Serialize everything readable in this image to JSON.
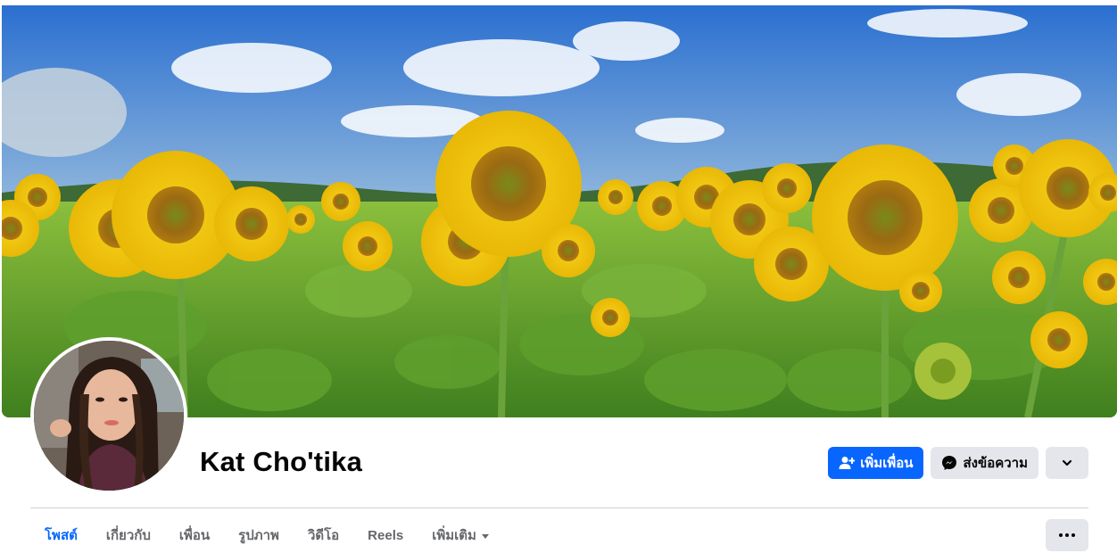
{
  "profile": {
    "name": "Kat Cho'tika"
  },
  "actions": {
    "add_friend_label": "เพิ่มเพื่อน",
    "message_label": "ส่งข้อความ"
  },
  "tabs": [
    {
      "label": "โพสต์",
      "active": true
    },
    {
      "label": "เกี่ยวกับ",
      "active": false
    },
    {
      "label": "เพื่อน",
      "active": false
    },
    {
      "label": "รูปภาพ",
      "active": false
    },
    {
      "label": "วิดีโอ",
      "active": false
    },
    {
      "label": "Reels",
      "active": false
    },
    {
      "label": "เพิ่มเติม",
      "active": false
    }
  ],
  "icons": {
    "add_friend": "person-add-icon",
    "message": "messenger-icon",
    "dropdown": "chevron-down-icon",
    "more": "ellipsis-icon",
    "tab_more": "caret-down-icon"
  },
  "colors": {
    "accent": "#0866ff",
    "secondary_button": "#e4e6eb",
    "text_primary": "#050505",
    "text_secondary": "#65676b",
    "divider": "#ced0d4"
  }
}
